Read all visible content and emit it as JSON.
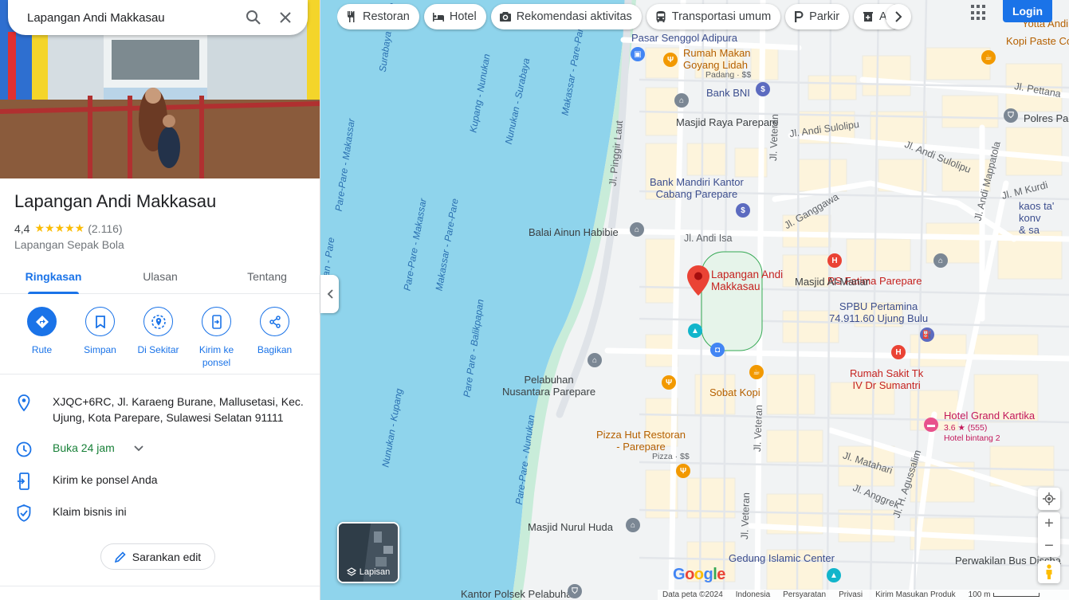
{
  "search": {
    "query": "Lapangan Andi Makkasau"
  },
  "place": {
    "name": "Lapangan Andi Makkasau",
    "rating": "4,4",
    "stars": "★★★★★",
    "review_count": "(2.116)",
    "category": "Lapangan Sepak Bola"
  },
  "tabs": [
    {
      "label": "Ringkasan",
      "active": true
    },
    {
      "label": "Ulasan",
      "active": false
    },
    {
      "label": "Tentang",
      "active": false
    }
  ],
  "actions": [
    {
      "label": "Rute",
      "icon": "directions-icon"
    },
    {
      "label": "Simpan",
      "icon": "bookmark-icon"
    },
    {
      "label": "Di Sekitar",
      "icon": "nearby-icon"
    },
    {
      "label": "Kirim ke ponsel",
      "icon": "send-to-phone-icon"
    },
    {
      "label": "Bagikan",
      "icon": "share-icon"
    }
  ],
  "info": {
    "address": "XJQC+6RC, Jl. Karaeng Burane, Mallusetasi, Kec. Ujung, Kota Parepare, Sulawesi Selatan 91111",
    "hours": "Buka 24 jam",
    "send_to_phone": "Kirim ke ponsel Anda",
    "claim": "Klaim bisnis ini"
  },
  "suggest_edit": "Sarankan edit",
  "chips": [
    {
      "label": "Restoran",
      "icon": "restaurant-icon"
    },
    {
      "label": "Hotel",
      "icon": "hotel-icon"
    },
    {
      "label": "Rekomendasi aktivitas",
      "icon": "camera-icon"
    },
    {
      "label": "Transportasi umum",
      "icon": "transit-icon"
    },
    {
      "label": "Parkir",
      "icon": "parking-icon"
    },
    {
      "label": "Ap",
      "icon": "pharmacy-icon"
    }
  ],
  "header": {
    "login": "Login"
  },
  "map": {
    "selected_label": "Lapangan Andi\nMakkasau",
    "labels": {
      "pasar": "Pasar Senggol Adipura",
      "rumah_makan": "Rumah Makan\nGoyang Lidah",
      "rumah_makan_sub": "Padang · $$",
      "kopi_paste": "Kopi Paste Coffe",
      "yotta": "Yotta Andi",
      "bank_bni": "Bank BNI",
      "masjid_raya": "Masjid Raya Parepare",
      "polres": "Polres Pa",
      "bank_mandiri": "Bank Mandiri Kantor\nCabang Parepare",
      "balai": "Balai Ainun Habibie",
      "kaos": "kaos ta' konv\n& sa",
      "rs_fatima": "RS Fatima Parepare",
      "masjid_almanar": "Masjid Al-Manar",
      "spbu": "SPBU Pertamina\n74.911.60 Ujung Bulu",
      "pelabuhan": "Pelabuhan\nNusantara Parepare",
      "sobat_kopi": "Sobat Kopi",
      "rs_tk": "Rumah Sakit Tk\nIV Dr Sumantri",
      "hotel_grand": "Hotel Grand Kartika",
      "hotel_grand_sub": "3.6 ★ (555)",
      "hotel_grand_sub2": "Hotel bintang 2",
      "pizza": "Pizza Hut Restoran\n- Parepare",
      "pizza_sub": "Pizza · $$",
      "masjid_nurul": "Masjid Nurul Huda",
      "gedung": "Gedung Islamic Center",
      "perwakilan": "Perwakilan Bus Discha",
      "kantor_polsek": "Kantor Polsek Pelabuhan"
    },
    "roads": {
      "andi_isa": "Jl. Andi Isa",
      "ganggawa": "Jl. Ganggawa",
      "andi_sulolipu": "Jl. Andi Sulolipu",
      "andi_sulolipu2": "Jl. Andi Sulolipu",
      "pinggir_laut": "Jl. Pinggir Laut",
      "veteran": "Jl. Veteran",
      "veteran2": "Jl. Veteran",
      "veteran3": "Jl. Veteran",
      "mappatola": "Jl. Andi Mappatola",
      "m_kurdi": "Jl. M Kurdi",
      "pettana": "Jl. Pettana",
      "matahari": "Jl. Matahari",
      "anggrek": "Jl. Anggrek",
      "agussalim": "Jl. H. Agussalim"
    },
    "water": [
      "Surabaya - Pare",
      "Pare-Pare - Makassar",
      "Kupang - Nunukan",
      "Nunukan - Surabaya",
      "Makassar - Pare-Pare",
      "Pare-Pare - Makassar",
      "Makassar - Pare-Pare",
      "Pare Pare - Balikpapan",
      "Nunukan - Kupang",
      "Pare-Pare - Nunukan",
      "Makassar - Pare-Pare",
      "Makassar - Pare-Pare",
      "Nunukan - Kupang",
      "Pare-Pare - Makassar",
      "ipan - Pare"
    ],
    "layers_label": "Lapisan",
    "google": "Google"
  },
  "footer": {
    "data": "Data peta ©2024",
    "country": "Indonesia",
    "terms": "Persyaratan",
    "privacy": "Privasi",
    "feedback": "Kirim Masukan Produk",
    "scale": "100 m"
  },
  "colors": {
    "accent": "#1a73e8",
    "water": "#8fd4ec",
    "land": "#f8f9fa",
    "pin_red": "#ea4335",
    "star": "#fbbc04",
    "open_green": "#188038"
  }
}
